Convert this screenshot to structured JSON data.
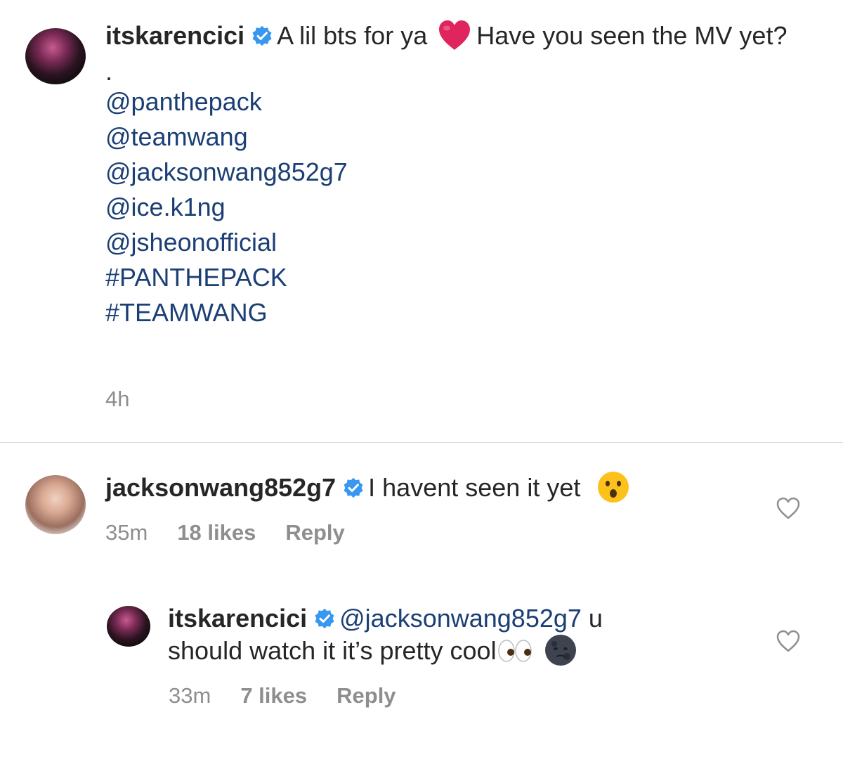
{
  "post": {
    "username": "itskarencici",
    "caption_part1": "A lil bts for ya",
    "caption_part2": "Have you seen the MV yet?",
    "dot": ".",
    "tags": [
      "@panthepack",
      "@teamwang",
      "@jacksonwang852g7",
      "@ice.k1ng",
      "@jsheonofficial",
      "#PANTHEPACK",
      "#TEAMWANG"
    ],
    "time": "4h"
  },
  "comments": [
    {
      "username": "jacksonwang852g7",
      "text": "I havent seen it yet",
      "time": "35m",
      "likes": "18 likes",
      "reply": "Reply",
      "emoji": "hushed-face"
    },
    {
      "username": "itskarencici",
      "mention": "@jacksonwang852g7",
      "text_line1": "u",
      "text_line2": "should watch it it’s pretty cool",
      "time": "33m",
      "likes": "7 likes",
      "reply": "Reply",
      "emoji": [
        "eyes",
        "new-moon-face"
      ]
    }
  ],
  "colors": {
    "link": "#1b3f75",
    "verified": "#3897f0",
    "meta": "#8e8e8e",
    "heart": "#e0245e"
  }
}
